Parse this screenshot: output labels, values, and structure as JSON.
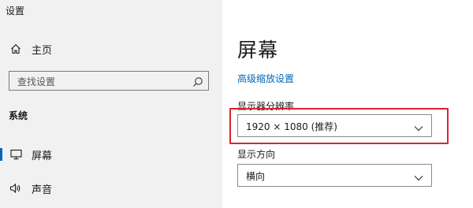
{
  "window": {
    "app_title": "设置"
  },
  "sidebar": {
    "home_label": "主页",
    "search_placeholder": "查找设置",
    "section_heading": "系统",
    "items": [
      {
        "label": "屏幕",
        "icon": "monitor-icon",
        "selected": true
      },
      {
        "label": "声音",
        "icon": "speaker-icon",
        "selected": false
      }
    ]
  },
  "main": {
    "page_title": "屏幕",
    "advanced_scaling_link": "高级缩放设置",
    "resolution": {
      "label": "显示器分辨率",
      "value": "1920 × 1080 (推荐)"
    },
    "orientation": {
      "label": "显示方向",
      "value": "横向"
    }
  },
  "colors": {
    "accent": "#0067b8",
    "sidebar_bg": "#f1f1f1",
    "highlight": "#d8262e"
  }
}
